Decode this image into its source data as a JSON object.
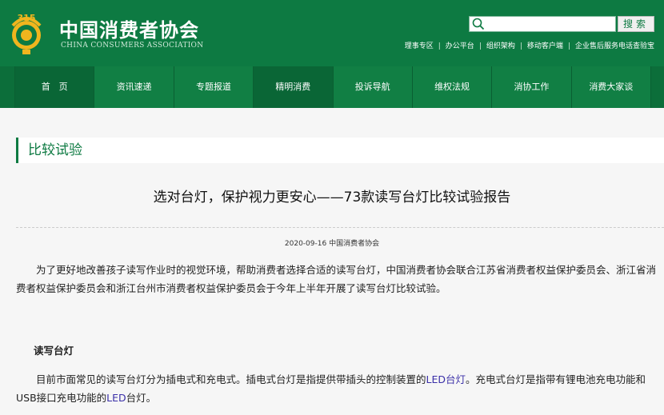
{
  "header": {
    "logo_label": "315",
    "brand_cn": "中国消费者协会",
    "brand_en": "CHINA CONSUMERS ASSOCIATION",
    "search": {
      "placeholder": "",
      "button": "搜索"
    },
    "top_links": [
      "理事专区",
      "办公平台",
      "组织架构",
      "移动客户端",
      "企业售后服务电话查验宝"
    ]
  },
  "nav": [
    "首　页",
    "资讯速递",
    "专题报道",
    "精明消费",
    "投诉导航",
    "维权法规",
    "消协工作",
    "消费大家谈"
  ],
  "section_title": "比较试验",
  "article": {
    "title": "选对台灯，保护视力更安心——73款读写台灯比较试验报告",
    "meta": "2020-09-16 中国消费者协会",
    "p1": "为了更好地改善孩子读写作业时的视觉环境，帮助消费者选择合适的读写台灯，中国消费者协会联合江苏省消费者权益保护委员会、浙江省消费者权益保护委员会和浙江台州市消费者权益保护委员会于今年上半年开展了读写台灯比较试验。",
    "subhead": "读写台灯",
    "p2_a": "目前市面常见的读写台灯分为插电式和充电式。插电式台灯是指提供带插头的控制装置的",
    "p2_link1": "LED台灯",
    "p2_b": "。充电式台灯是指带有锂电池充电功能和USB接口充电功能的",
    "p2_link2": "LED",
    "p2_c": "台灯。"
  },
  "colors": {
    "brand_green": "#0d7a42",
    "nav_dark": "#0a6636",
    "link_purple": "#3a2fa8"
  }
}
